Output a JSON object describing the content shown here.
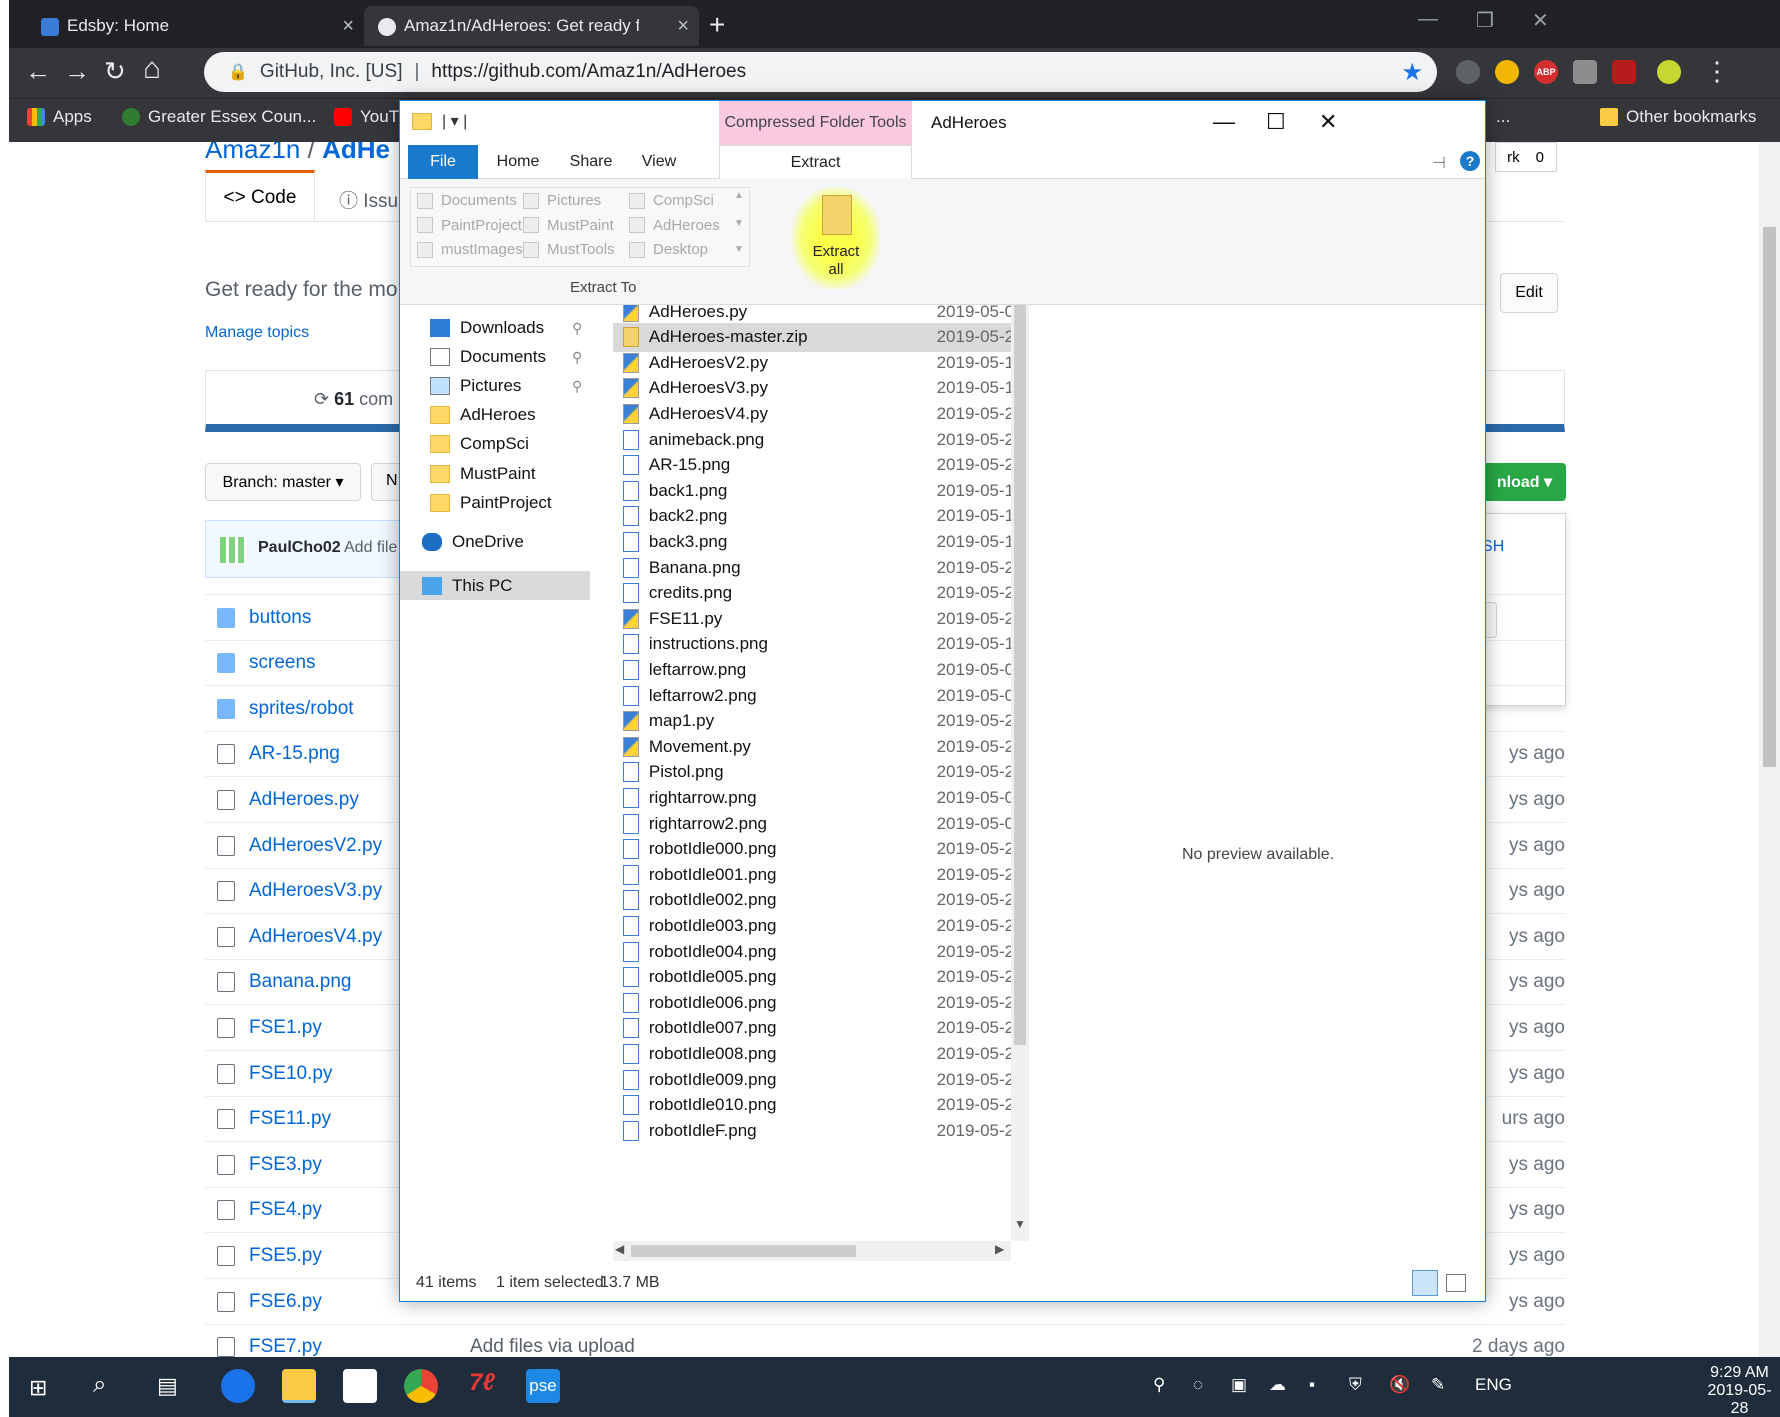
{
  "browser": {
    "tabs": [
      {
        "title": "Edsby: Home",
        "close": "×"
      },
      {
        "title": "Amaz1n/AdHeroes: Get ready for",
        "close": "×"
      }
    ],
    "new_tab": "+",
    "window_controls": {
      "minimize": "—",
      "restore": "❐",
      "close": "✕"
    },
    "nav": {
      "back": "←",
      "forward": "→",
      "reload": "↻",
      "home": "⌂"
    },
    "omnibox": {
      "site": "GitHub, Inc. [US]",
      "separator": "|",
      "url": "https://github.com/Amaz1n/AdHeroes",
      "star": "★"
    },
    "menu": "⋮",
    "bookmarks": [
      {
        "label": "Apps"
      },
      {
        "label": "Greater Essex Coun..."
      },
      {
        "label": "YouT"
      },
      {
        "label": "..."
      },
      {
        "label": "Other bookmarks"
      }
    ]
  },
  "github": {
    "repo_owner": "Amaz1n",
    "repo_sep": "/",
    "repo_name": "AdHe",
    "tab_code": "<> Code",
    "tab_issues": "Issues",
    "description": "Get ready for the mo",
    "manage_topics": "Manage topics",
    "edit": "Edit",
    "commits_count": "61",
    "commits_label": "com",
    "branch": "Branch: master ▾",
    "new_pr": "N",
    "download": "nload ▾",
    "use_ssh": "se SSH",
    "clipboard": "⎘",
    "open_p": "P",
    "fork_label": "rk",
    "fork_count": "0",
    "commit_author": "PaulCho02",
    "commit_msg": "Add file",
    "files": [
      {
        "name": "buttons",
        "type": "dir",
        "ago": ""
      },
      {
        "name": "screens",
        "type": "dir",
        "ago": ""
      },
      {
        "name": "sprites/robot",
        "type": "dir",
        "ago": ""
      },
      {
        "name": "AR-15.png",
        "type": "file",
        "ago": "ys ago"
      },
      {
        "name": "AdHeroes.py",
        "type": "file",
        "ago": "ys ago"
      },
      {
        "name": "AdHeroesV2.py",
        "type": "file",
        "ago": "ys ago"
      },
      {
        "name": "AdHeroesV3.py",
        "type": "file",
        "ago": "ys ago"
      },
      {
        "name": "AdHeroesV4.py",
        "type": "file",
        "ago": "ys ago"
      },
      {
        "name": "Banana.png",
        "type": "file",
        "ago": "ys ago"
      },
      {
        "name": "FSE1.py",
        "type": "file",
        "ago": "ys ago"
      },
      {
        "name": "FSE10.py",
        "type": "file",
        "ago": "ys ago"
      },
      {
        "name": "FSE11.py",
        "type": "file",
        "ago": "urs ago"
      },
      {
        "name": "FSE3.py",
        "type": "file",
        "ago": "ys ago"
      },
      {
        "name": "FSE4.py",
        "type": "file",
        "ago": "ys ago"
      },
      {
        "name": "FSE5.py",
        "type": "file",
        "ago": "ys ago"
      },
      {
        "name": "FSE6.py",
        "type": "file",
        "ago": "ys ago"
      },
      {
        "name": "FSE7.py",
        "type": "file",
        "ago": "2 days ago"
      }
    ],
    "last_row_message": "Add files via upload"
  },
  "explorer": {
    "title": "AdHeroes",
    "context_tab": "Compressed Folder Tools",
    "ribbon_tabs": {
      "file": "File",
      "home": "Home",
      "share": "Share",
      "view": "View",
      "extract": "Extract"
    },
    "destinations": [
      [
        "Documents",
        "Pictures",
        "CompSci"
      ],
      [
        "PaintProject",
        "MustPaint",
        "AdHeroes"
      ],
      [
        "mustImages",
        "MustTools",
        "Desktop"
      ]
    ],
    "extract_all": [
      "Extract",
      "all"
    ],
    "group_label": "Extract To",
    "nav_items": [
      {
        "label": "Downloads",
        "pin": "📌"
      },
      {
        "label": "Documents",
        "pin": "📌"
      },
      {
        "label": "Pictures",
        "pin": "📌"
      },
      {
        "label": "AdHeroes"
      },
      {
        "label": "CompSci"
      },
      {
        "label": "MustPaint"
      },
      {
        "label": "PaintProject"
      },
      {
        "label": "OneDrive"
      },
      {
        "label": "This PC"
      }
    ],
    "files": [
      {
        "name": "AdHeroes.py",
        "date": "2019-05-0",
        "kind": "py"
      },
      {
        "name": "AdHeroes-master.zip",
        "date": "2019-05-2",
        "kind": "zip",
        "selected": true
      },
      {
        "name": "AdHeroesV2.py",
        "date": "2019-05-1",
        "kind": "py"
      },
      {
        "name": "AdHeroesV3.py",
        "date": "2019-05-1",
        "kind": "py"
      },
      {
        "name": "AdHeroesV4.py",
        "date": "2019-05-2",
        "kind": "py"
      },
      {
        "name": "animeback.png",
        "date": "2019-05-2",
        "kind": "png"
      },
      {
        "name": "AR-15.png",
        "date": "2019-05-2",
        "kind": "png"
      },
      {
        "name": "back1.png",
        "date": "2019-05-1",
        "kind": "png"
      },
      {
        "name": "back2.png",
        "date": "2019-05-1",
        "kind": "png"
      },
      {
        "name": "back3.png",
        "date": "2019-05-1",
        "kind": "png"
      },
      {
        "name": "Banana.png",
        "date": "2019-05-2",
        "kind": "png"
      },
      {
        "name": "credits.png",
        "date": "2019-05-2",
        "kind": "png"
      },
      {
        "name": "FSE11.py",
        "date": "2019-05-2",
        "kind": "py"
      },
      {
        "name": "instructions.png",
        "date": "2019-05-1",
        "kind": "png"
      },
      {
        "name": "leftarrow.png",
        "date": "2019-05-0",
        "kind": "png"
      },
      {
        "name": "leftarrow2.png",
        "date": "2019-05-0",
        "kind": "png"
      },
      {
        "name": "map1.py",
        "date": "2019-05-2",
        "kind": "py"
      },
      {
        "name": "Movement.py",
        "date": "2019-05-2",
        "kind": "py"
      },
      {
        "name": "Pistol.png",
        "date": "2019-05-2",
        "kind": "png"
      },
      {
        "name": "rightarrow.png",
        "date": "2019-05-0",
        "kind": "png"
      },
      {
        "name": "rightarrow2.png",
        "date": "2019-05-0",
        "kind": "png"
      },
      {
        "name": "robotIdle000.png",
        "date": "2019-05-2",
        "kind": "png"
      },
      {
        "name": "robotIdle001.png",
        "date": "2019-05-2",
        "kind": "png"
      },
      {
        "name": "robotIdle002.png",
        "date": "2019-05-2",
        "kind": "png"
      },
      {
        "name": "robotIdle003.png",
        "date": "2019-05-2",
        "kind": "png"
      },
      {
        "name": "robotIdle004.png",
        "date": "2019-05-2",
        "kind": "png"
      },
      {
        "name": "robotIdle005.png",
        "date": "2019-05-2",
        "kind": "png"
      },
      {
        "name": "robotIdle006.png",
        "date": "2019-05-2",
        "kind": "png"
      },
      {
        "name": "robotIdle007.png",
        "date": "2019-05-2",
        "kind": "png"
      },
      {
        "name": "robotIdle008.png",
        "date": "2019-05-2",
        "kind": "png"
      },
      {
        "name": "robotIdle009.png",
        "date": "2019-05-2",
        "kind": "png"
      },
      {
        "name": "robotIdle010.png",
        "date": "2019-05-2",
        "kind": "png"
      },
      {
        "name": "robotIdleF.png",
        "date": "2019-05-2",
        "kind": "png"
      }
    ],
    "preview_text": "No preview available.",
    "status_items": "41 items",
    "status_selected": "1 item selected",
    "status_size": "13.7 MB"
  },
  "taskbar": {
    "lang": "ENG",
    "time": "9:29 AM",
    "date": "2019-05-28",
    "pse": "pse"
  },
  "colors": {
    "explorer_accent": "#1979ca",
    "highlight": "#fbff4a",
    "github_link": "#0366d6",
    "github_green": "#28a745"
  }
}
